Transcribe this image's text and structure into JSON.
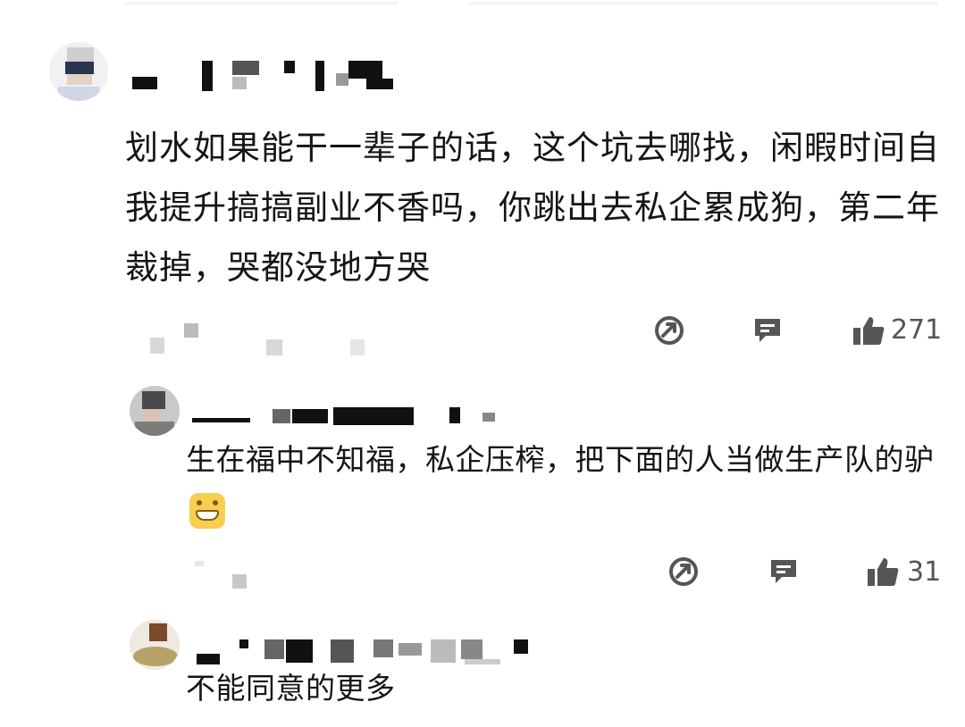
{
  "comments": [
    {
      "username": "",
      "text": "划水如果能干一辈子的话，这个坑去哪找，闲暇时间自我提升搞搞副业不香吗，你跳出去私企累成狗，第二年裁掉，哭都没地方哭",
      "likes": "271",
      "replies": [
        {
          "username": "",
          "text": "生在福中不知福，私企压榨，把下面的人当做生产队的驴",
          "emoji": "grinning-face-emoji",
          "likes": "31"
        },
        {
          "username": "",
          "text": "不能同意的更多"
        }
      ]
    }
  ],
  "icons": {
    "share": "share-icon",
    "reply": "comment-icon",
    "like": "thumbs-up-icon"
  },
  "colors": {
    "icon": "#555555",
    "text": "#151515"
  }
}
